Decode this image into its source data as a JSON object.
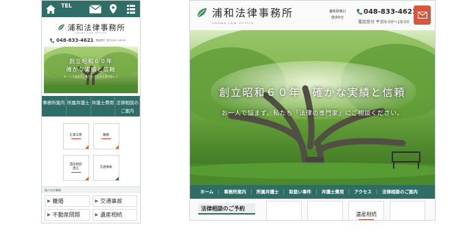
{
  "colors": {
    "brand_green": "#2f6e66",
    "accent_red": "#d9553b",
    "underline_red": "#c0392b",
    "corner_orange": "#c8632e"
  },
  "mobile": {
    "topbar": {
      "home_icon": "home-icon",
      "tel_label": "TEL",
      "mail_icon": "mail-icon",
      "pin_icon": "map-pin-icon",
      "menu_icon": "menu-icon"
    },
    "logo": {
      "name": "浦和法律事務所",
      "sub": "URAWA LAW OFFICE"
    },
    "contact": {
      "phone": "048-833-4621",
      "hours": "電話受付 平日9:00～18:00"
    },
    "hero": {
      "line1": "創立昭和６０年",
      "line2": "確かな実績と信頼",
      "line3": "お一人で悩まず、私たち「法律の専門家」に"
    },
    "nav": [
      "事務所案内",
      "所属弁護士",
      "弁護士費用",
      "法律相談のご案内"
    ],
    "tiles": [
      {
        "label": "企業法務",
        "corner": "orange",
        "underline": true
      },
      {
        "label": "離婚",
        "corner": "orange",
        "underline": true
      },
      {
        "label": "遺産相続\n遺言",
        "corner": "orange",
        "underline": true
      },
      {
        "label": "交通事故",
        "corner": "green",
        "underline": false
      }
    ],
    "section_title": "個人の方事務",
    "list": [
      "離婚",
      "交通事故",
      "不動産問題",
      "遺産相続"
    ]
  },
  "desktop": {
    "logo": {
      "name": "浦和法律事務所",
      "sub": "URAWA LAW OFFICE"
    },
    "access": "浦和駅西口\n徒歩6分",
    "phone": "048-833-4621",
    "hours": "電話受付 平日9:00～18:00",
    "hero": {
      "title": "創立昭和６０年　確かな実績と信頼",
      "subtitle": "お一人で悩まず、私たち「法律の専門家」にご相談ください。"
    },
    "nav": [
      "ホーム",
      "事務所案内",
      "所属弁護士",
      "取扱い事件",
      "弁護士費用",
      "アクセス",
      "法律相談のご案内"
    ],
    "consult_heading": "法律相談のご予約",
    "cards": [
      "",
      "",
      "遺産相続",
      ""
    ]
  }
}
